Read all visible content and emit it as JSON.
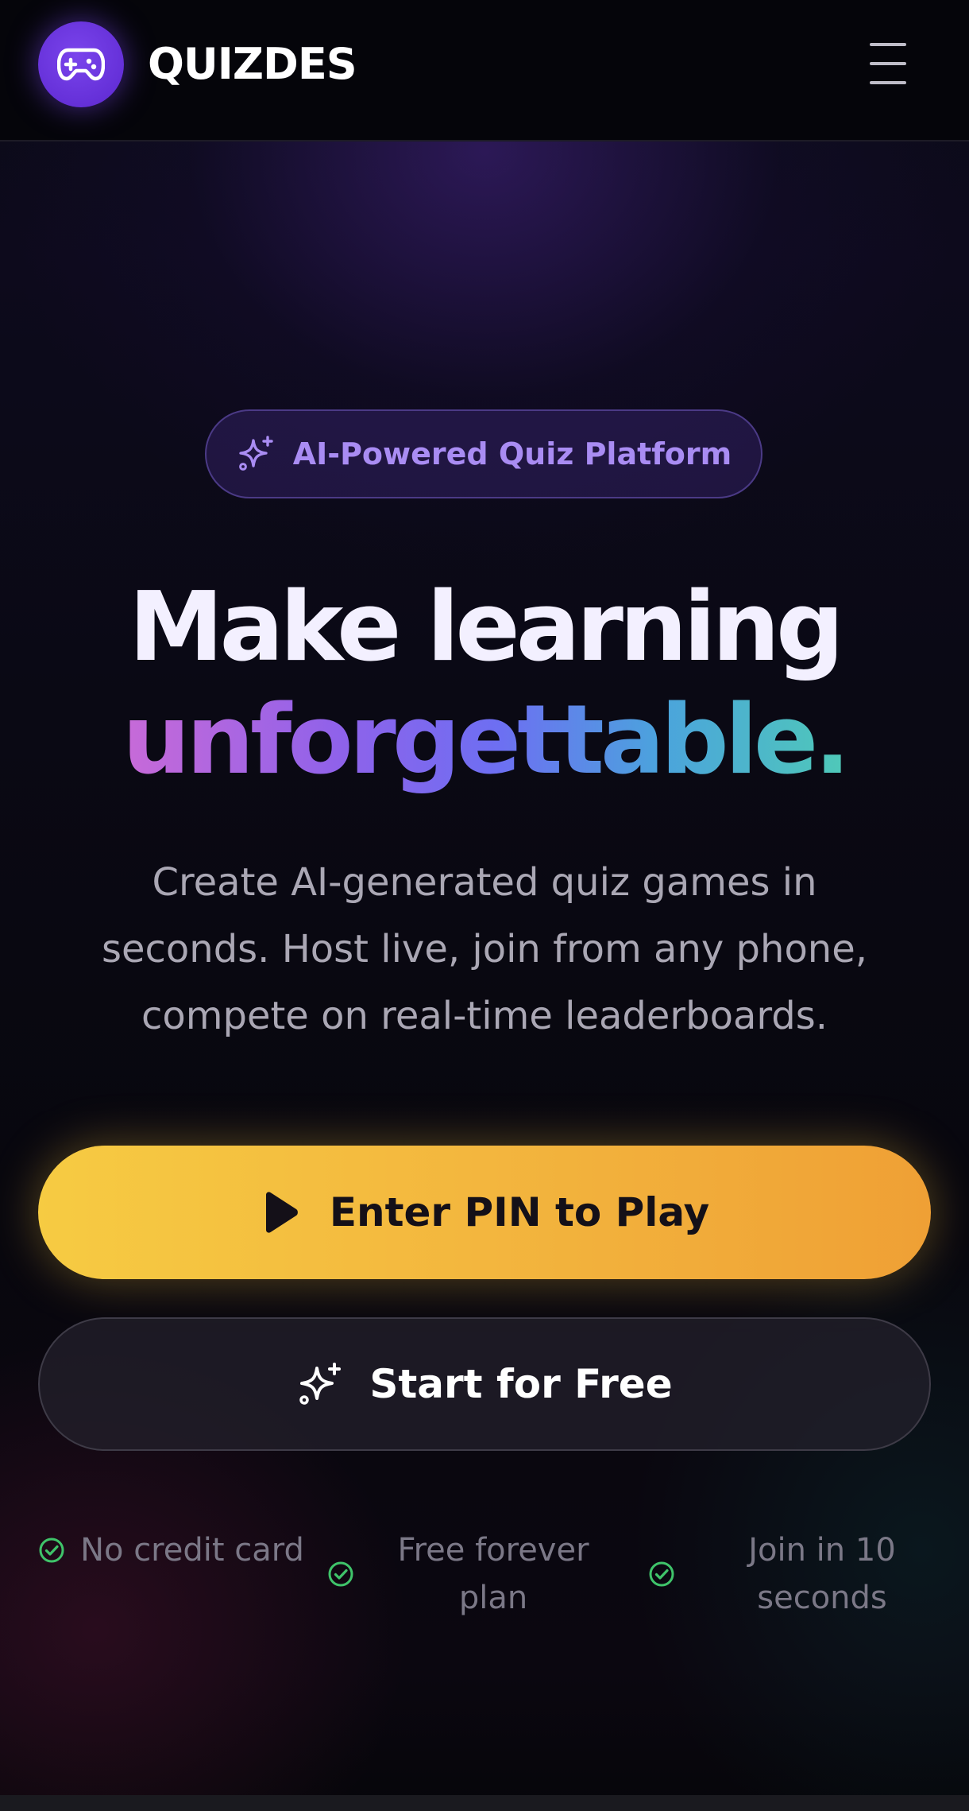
{
  "header": {
    "brand": "QUIZDES",
    "logo_icon": "gamepad-icon",
    "menu_icon": "hamburger-menu-icon"
  },
  "hero": {
    "badge_icon": "sparkles-icon",
    "badge_text": "AI-Powered Quiz Platform",
    "headline_line1": "Make learning",
    "headline_line2": "unforgettable.",
    "subtext": "Create AI-generated quiz games in seconds. Host live, join from any phone, compete on real-time leaderboards."
  },
  "actions": {
    "primary_icon": "play-icon",
    "primary_label": "Enter PIN to Play",
    "secondary_icon": "sparkles-icon",
    "secondary_label": "Start for Free"
  },
  "features": [
    {
      "icon": "check-circle-icon",
      "text": "No credit card"
    },
    {
      "icon": "check-circle-icon",
      "text": "Free forever plan"
    },
    {
      "icon": "check-circle-icon",
      "text": "Join in 10 seconds"
    }
  ],
  "colors": {
    "brand_purple": "#6a33dc",
    "badge_text": "#a98cf3",
    "primary_button_start": "#f6cb42",
    "primary_button_end": "#efa035",
    "check_green": "#3fc46a",
    "headline_gradient": [
      "#c86ad8",
      "#8f62ea",
      "#6d6ff2",
      "#4ba3dd",
      "#4fc9b8"
    ]
  }
}
